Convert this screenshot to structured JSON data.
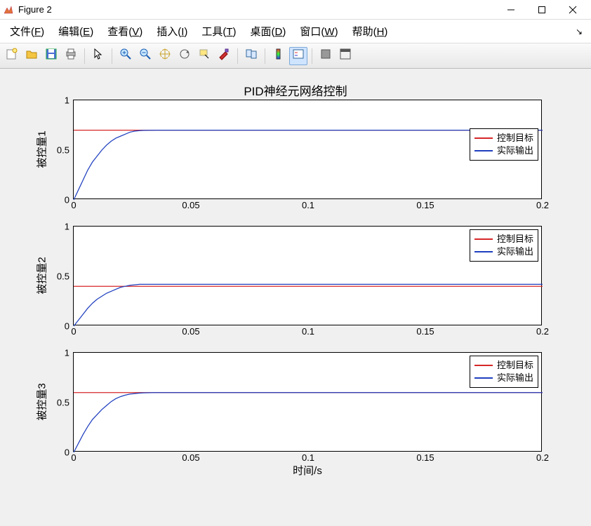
{
  "window": {
    "title": "Figure 2"
  },
  "menubar": {
    "items": [
      {
        "label": "文件",
        "key": "F"
      },
      {
        "label": "编辑",
        "key": "E"
      },
      {
        "label": "查看",
        "key": "V"
      },
      {
        "label": "插入",
        "key": "I"
      },
      {
        "label": "工具",
        "key": "T"
      },
      {
        "label": "桌面",
        "key": "D"
      },
      {
        "label": "窗口",
        "key": "W"
      },
      {
        "label": "帮助",
        "key": "H"
      }
    ]
  },
  "toolbar": {
    "items": [
      "new-figure",
      "open",
      "save",
      "print",
      "|",
      "pointer",
      "|",
      "zoom-in",
      "zoom-out",
      "pan",
      "rotate",
      "data-cursor",
      "brush",
      "|",
      "link",
      "|",
      "colorbar",
      "legend",
      "|",
      "hide",
      "dock"
    ]
  },
  "chart_data": [
    {
      "type": "line",
      "title": "PID神经元网络控制",
      "ylabel": "被控量1",
      "xlim": [
        0,
        0.2
      ],
      "ylim": [
        0,
        1
      ],
      "xticks": [
        0,
        0.05,
        0.1,
        0.15,
        0.2
      ],
      "yticks": [
        0,
        0.5,
        1
      ],
      "legend": {
        "position": "upper-right",
        "entries": [
          "控制目标",
          "实际输出"
        ]
      },
      "series": [
        {
          "name": "控制目标",
          "color": "#d62728",
          "x": [
            0,
            0.2
          ],
          "y": [
            0.7,
            0.7
          ]
        },
        {
          "name": "实际输出",
          "color": "#1f3fbf",
          "x": [
            0,
            0.002,
            0.004,
            0.006,
            0.008,
            0.01,
            0.012,
            0.014,
            0.016,
            0.018,
            0.02,
            0.022,
            0.024,
            0.026,
            0.028,
            0.03,
            0.035,
            0.04,
            0.05,
            0.06,
            0.08,
            0.1,
            0.15,
            0.2
          ],
          "y": [
            0.0,
            0.1,
            0.2,
            0.3,
            0.38,
            0.44,
            0.5,
            0.55,
            0.59,
            0.62,
            0.64,
            0.66,
            0.68,
            0.69,
            0.695,
            0.698,
            0.7,
            0.7,
            0.7,
            0.7,
            0.7,
            0.7,
            0.7,
            0.7
          ]
        }
      ]
    },
    {
      "type": "line",
      "ylabel": "被控量2",
      "xlim": [
        0,
        0.2
      ],
      "ylim": [
        0,
        1
      ],
      "xticks": [
        0,
        0.05,
        0.1,
        0.15,
        0.2
      ],
      "yticks": [
        0,
        0.5,
        1
      ],
      "legend": {
        "position": "upper-right",
        "entries": [
          "控制目标",
          "实际输出"
        ]
      },
      "series": [
        {
          "name": "控制目标",
          "color": "#d62728",
          "x": [
            0,
            0.2
          ],
          "y": [
            0.4,
            0.4
          ]
        },
        {
          "name": "实际输出",
          "color": "#1f3fbf",
          "x": [
            0,
            0.002,
            0.004,
            0.006,
            0.008,
            0.01,
            0.012,
            0.014,
            0.016,
            0.018,
            0.02,
            0.022,
            0.024,
            0.026,
            0.028,
            0.03,
            0.035,
            0.04,
            0.05,
            0.06,
            0.08,
            0.1,
            0.15,
            0.2
          ],
          "y": [
            0.0,
            0.06,
            0.12,
            0.18,
            0.23,
            0.27,
            0.3,
            0.33,
            0.35,
            0.37,
            0.39,
            0.4,
            0.41,
            0.415,
            0.42,
            0.42,
            0.42,
            0.42,
            0.42,
            0.42,
            0.42,
            0.42,
            0.42,
            0.42
          ]
        }
      ]
    },
    {
      "type": "line",
      "ylabel": "被控量3",
      "xlabel": "时间/s",
      "xlim": [
        0,
        0.2
      ],
      "ylim": [
        0,
        1
      ],
      "xticks": [
        0,
        0.05,
        0.1,
        0.15,
        0.2
      ],
      "yticks": [
        0,
        0.5,
        1
      ],
      "legend": {
        "position": "upper-right",
        "entries": [
          "控制目标",
          "实际输出"
        ]
      },
      "series": [
        {
          "name": "控制目标",
          "color": "#d62728",
          "x": [
            0,
            0.2
          ],
          "y": [
            0.6,
            0.6
          ]
        },
        {
          "name": "实际输出",
          "color": "#1f3fbf",
          "x": [
            0,
            0.002,
            0.004,
            0.006,
            0.008,
            0.01,
            0.012,
            0.014,
            0.016,
            0.018,
            0.02,
            0.022,
            0.024,
            0.026,
            0.028,
            0.03,
            0.035,
            0.04,
            0.05,
            0.06,
            0.08,
            0.1,
            0.15,
            0.2
          ],
          "y": [
            0.0,
            0.09,
            0.18,
            0.26,
            0.33,
            0.38,
            0.43,
            0.47,
            0.51,
            0.54,
            0.56,
            0.575,
            0.585,
            0.59,
            0.595,
            0.598,
            0.6,
            0.6,
            0.6,
            0.6,
            0.6,
            0.6,
            0.6,
            0.6
          ]
        }
      ]
    }
  ]
}
